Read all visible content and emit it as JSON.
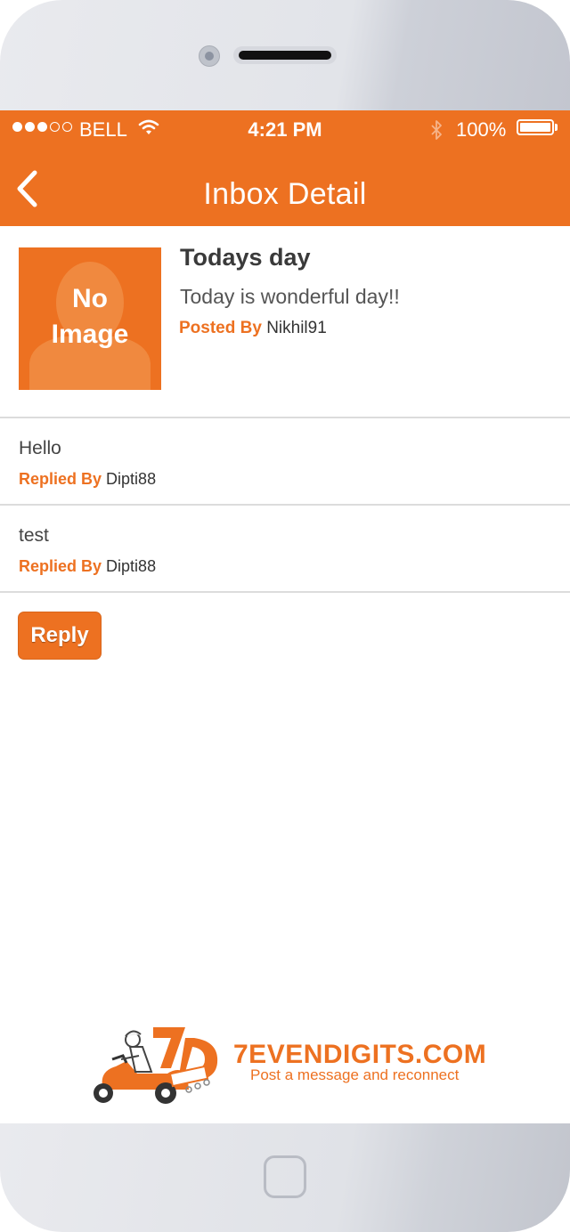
{
  "status_bar": {
    "carrier": "BELL",
    "time": "4:21 PM",
    "battery": "100%",
    "signal_strength": 3,
    "signal_max": 5
  },
  "nav": {
    "title": "Inbox Detail"
  },
  "post": {
    "image_placeholder_line1": "No",
    "image_placeholder_line2": "Image",
    "title": "Todays day",
    "body": "Today is wonderful day!!",
    "posted_by_label": "Posted By",
    "author": "Nikhil91"
  },
  "replies": [
    {
      "text": "Hello",
      "label": "Replied By",
      "author": "Dipti88"
    },
    {
      "text": "test",
      "label": "Replied By",
      "author": "Dipti88"
    }
  ],
  "reply_button": "Reply",
  "footer": {
    "brand": "7EVENDIGITS.COM",
    "tagline": "Post a message and reconnect",
    "logo_mark": "7D"
  },
  "colors": {
    "accent": "#ed7121"
  }
}
